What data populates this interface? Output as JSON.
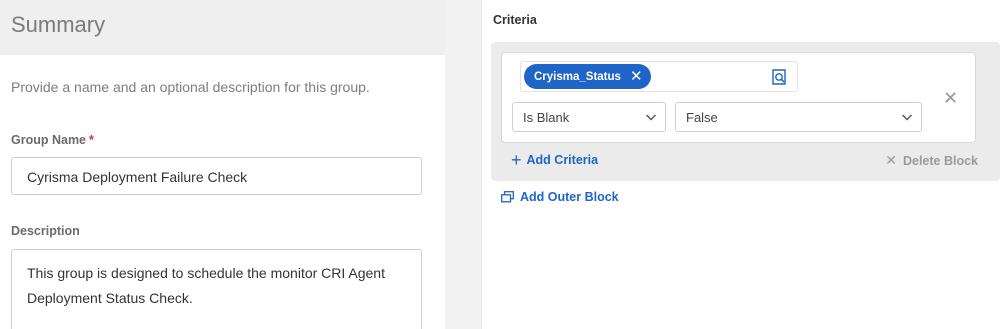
{
  "summary": {
    "title": "Summary",
    "intro": "Provide a name and an optional description for this group.",
    "group_name_label": "Group Name",
    "required_marker": "*",
    "group_name_value": "Cyrisma Deployment Failure Check",
    "description_label": "Description",
    "description_value": "This group is designed to schedule the monitor CRI Agent Deployment Status Check."
  },
  "criteria": {
    "label": "Criteria",
    "tag_label": "Cryisma_Status",
    "operator_value": "Is Blank",
    "value_value": "False",
    "add_criteria_label": "Add Criteria",
    "delete_block_label": "Delete Block",
    "add_outer_block_label": "Add Outer Block"
  },
  "icons": {
    "tag_remove": "close-icon",
    "lookup": "search-list-icon",
    "row_remove": "close-icon",
    "add": "plus-icon",
    "delete": "close-icon",
    "outer_block": "copy-block-icon",
    "dropdown": "chevron-down-icon"
  },
  "colors": {
    "accent": "#1f64c7",
    "required": "#d0342c",
    "header_bg": "#efefef",
    "block_bg": "#ebebeb"
  }
}
